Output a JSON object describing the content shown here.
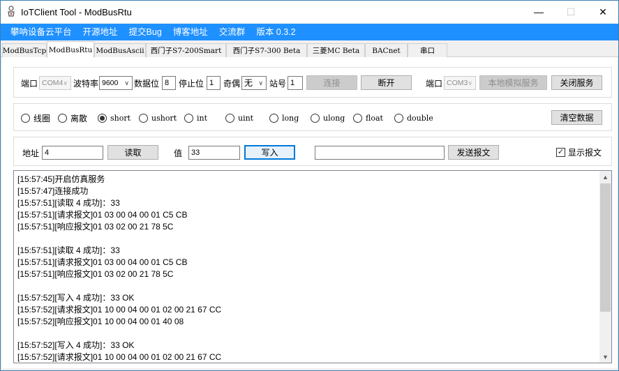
{
  "window": {
    "title": "IoTClient Tool - ModBusRtu",
    "minimize_glyph": "—",
    "maximize_glyph": "☐",
    "close_glyph": "✕"
  },
  "menu": [
    "攀呐设备云平台",
    "开源地址",
    "提交Bug",
    "博客地址",
    "交流群",
    "版本 0.3.2"
  ],
  "tabs": [
    "ModBusTcp",
    "ModBusRtu",
    "ModBusAscii",
    "西门子S7-200Smart",
    "西门子S7-300 Beta",
    "三菱MC Beta",
    "BACnet",
    "串口"
  ],
  "active_tab": "ModBusRtu",
  "connection": {
    "port_label": "端口",
    "port_value": "COM4",
    "baud_label": "波特率",
    "baud_value": "9600",
    "databits_label": "数据位",
    "databits_value": "8",
    "stopbits_label": "停止位",
    "stopbits_value": "1",
    "parity_label": "奇偶",
    "parity_value": "无",
    "station_label": "站号",
    "station_value": "1",
    "connect_label": "连接",
    "disconnect_label": "断开",
    "sim_port_label": "端口",
    "sim_port_value": "COM3",
    "local_sim_label": "本地模拟服务",
    "close_service_label": "关闭服务"
  },
  "datatypes": {
    "options": [
      "线圈",
      "离散",
      "short",
      "ushort",
      "int",
      "uint",
      "long",
      "ulong",
      "float",
      "double"
    ],
    "selected": "short",
    "clear_label": "清空数据"
  },
  "io": {
    "address_label": "地址",
    "address_value": "4",
    "read_label": "读取",
    "value_label": "值",
    "value_value": "33",
    "write_label": "写入",
    "send_input_value": "",
    "send_label": "发送报文",
    "show_message_label": "显示报文",
    "show_message_checked": true,
    "check_glyph": "✓"
  },
  "log": [
    "[15:57:45]开启仿真服务",
    "[15:57:47]连接成功",
    "[15:57:51][读取 4 成功]：33",
    "[15:57:51][请求报文]01 03 00 04 00 01 C5 CB",
    "[15:57:51][响应报文]01 03 02 00 21 78 5C",
    "",
    "[15:57:51][读取 4 成功]：33",
    "[15:57:51][请求报文]01 03 00 04 00 01 C5 CB",
    "[15:57:51][响应报文]01 03 02 00 21 78 5C",
    "",
    "[15:57:52][写入 4 成功]：33 OK",
    "[15:57:52][请求报文]01 10 00 04 00 01 02 00 21 67 CC",
    "[15:57:52][响应报文]01 10 00 04 00 01 40 08",
    "",
    "[15:57:52][写入 4 成功]：33 OK",
    "[15:57:52][请求报文]01 10 00 04 00 01 02 00 21 67 CC"
  ],
  "scroll": {
    "up_glyph": "▲",
    "down_glyph": "▼"
  }
}
